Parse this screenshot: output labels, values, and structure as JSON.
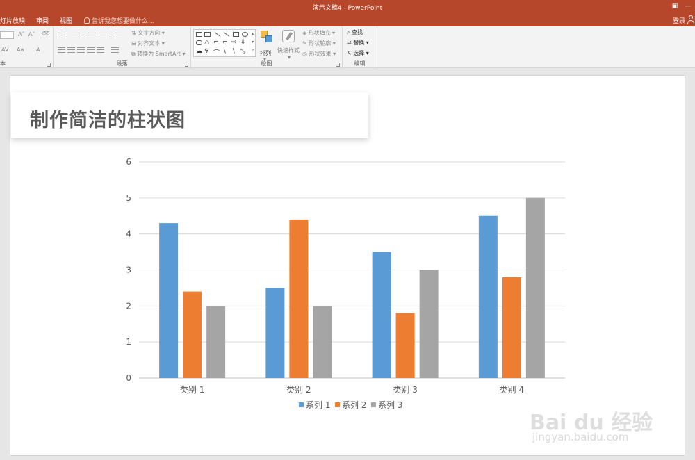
{
  "window": {
    "title": "演示文稿4 - PowerPoint"
  },
  "tabs": [
    {
      "label": "灯片放映"
    },
    {
      "label": "审阅"
    },
    {
      "label": "视图"
    }
  ],
  "tell_me": "告诉我您想要做什么...",
  "account": {
    "login": "登录"
  },
  "ribbon": {
    "paragraph": {
      "label": "段落",
      "text_direction": "文字方向",
      "align_text": "对齐文本",
      "smartart": "转换为 SmartArt"
    },
    "drawing": {
      "label": "绘图",
      "arrange": "排列",
      "quick_styles": "快速样式",
      "shape_fill": "形状填充",
      "shape_outline": "形状轮廓",
      "shape_effects": "形状效果"
    },
    "editing": {
      "label": "编辑",
      "find": "查找",
      "replace": "替换",
      "select": "选择"
    },
    "font_partial": {
      "label": "本"
    }
  },
  "slide": {
    "title": "制作简洁的柱状图"
  },
  "watermark": {
    "line1": "Bai du 经验",
    "line2": "jingyan.baidu.com"
  },
  "colors": {
    "accent": "#b7472a",
    "series1": "#5b9bd5",
    "series2": "#ed7d31",
    "series3": "#a5a5a5"
  },
  "chart_data": {
    "type": "bar",
    "categories": [
      "类别 1",
      "类别 2",
      "类别 3",
      "类别 4"
    ],
    "series": [
      {
        "name": "系列 1",
        "values": [
          4.3,
          2.5,
          3.5,
          4.5
        ]
      },
      {
        "name": "系列 2",
        "values": [
          2.4,
          4.4,
          1.8,
          2.8
        ]
      },
      {
        "name": "系列 3",
        "values": [
          2.0,
          2.0,
          3.0,
          5.0
        ]
      }
    ],
    "ylim": [
      0,
      6
    ],
    "yticks": [
      "0",
      "1",
      "2",
      "3",
      "4",
      "5",
      "6"
    ],
    "grid": true,
    "legend": "bottom"
  }
}
